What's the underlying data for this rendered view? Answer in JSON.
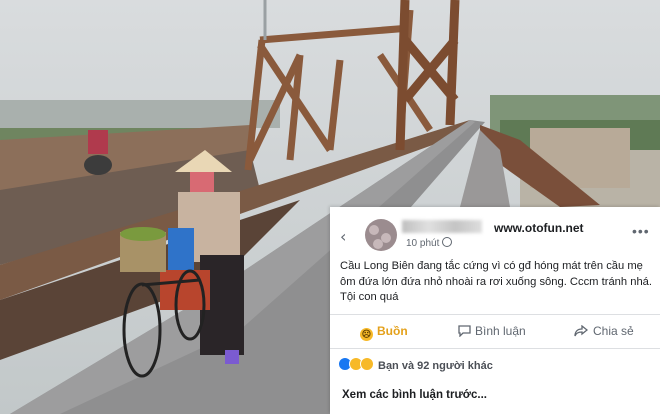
{
  "post": {
    "back_icon": "chevron-left-icon",
    "time": "10 phút",
    "site": "www.otofun.net",
    "more_icon": "ellipsis-icon",
    "text": "Cầu Long Biên đang tắc cứng vì có gđ hóng mát trên cầu mẹ ôm đứa lớn đứa nhỏ nhoài ra rơi xuống sông. Cccm tránh nhá. Tội con quá"
  },
  "actions": {
    "reaction_label": "Buồn",
    "comment_label": "Bình luận",
    "share_label": "Chia sẻ"
  },
  "reactions": {
    "text": "Bạn và 92 người khác"
  },
  "comments": {
    "previous_label": "Xem các bình luận trước..."
  },
  "colors": {
    "sad_reaction": "#e4a11b",
    "like_blue": "#1877f2",
    "text": "#1c1e21",
    "secondary": "#606770"
  }
}
